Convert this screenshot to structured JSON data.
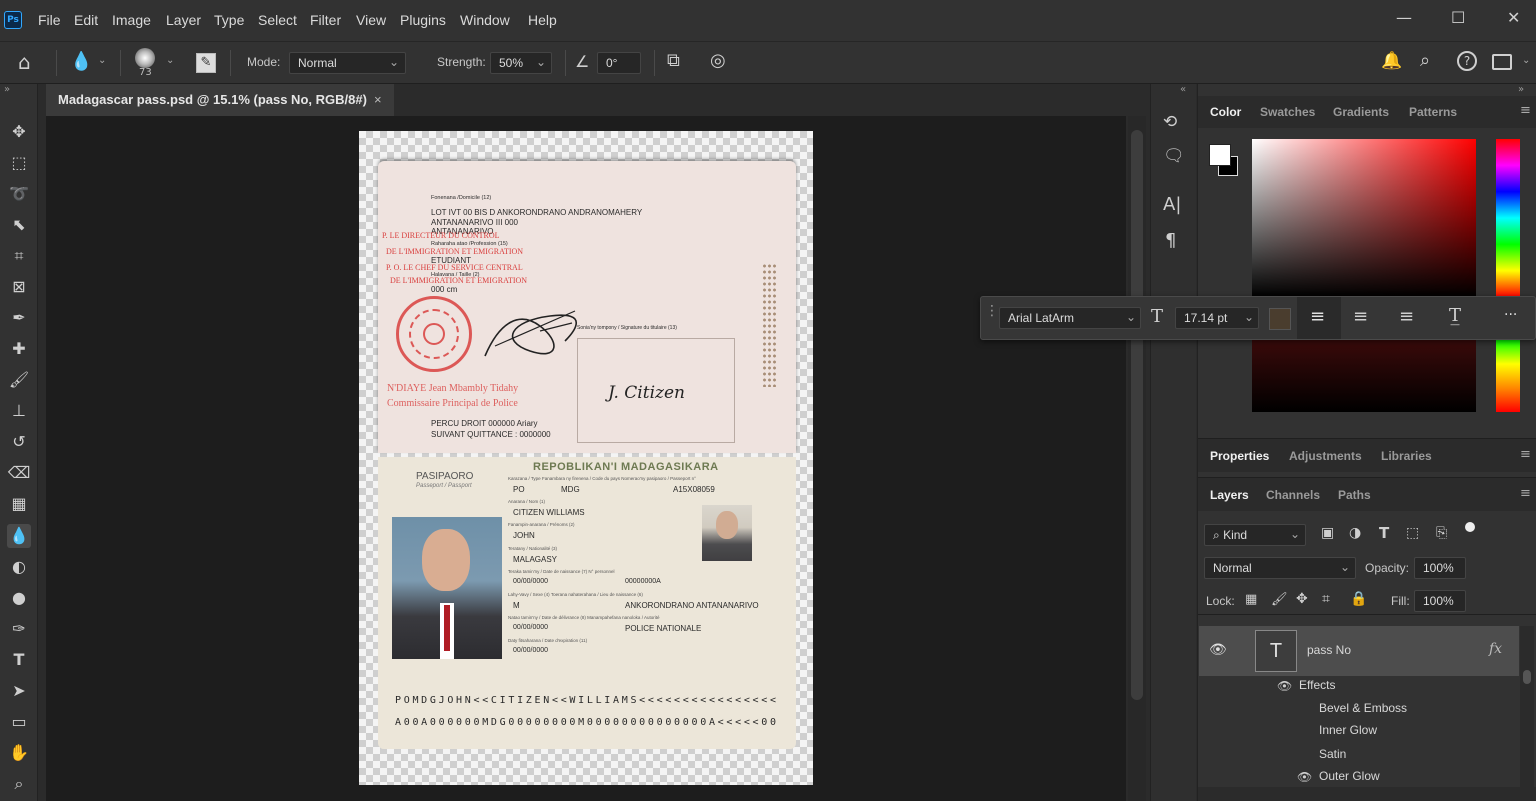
{
  "app": {
    "logo_text": "Ps"
  },
  "menu": [
    "File",
    "Edit",
    "Image",
    "Layer",
    "Type",
    "Select",
    "Filter",
    "View",
    "Plugins",
    "Window",
    "Help"
  ],
  "window_controls": {
    "minimize": "—",
    "maximize": "☐",
    "close": "✕"
  },
  "options": {
    "brush_size": "73",
    "mode_label": "Mode:",
    "mode_value": "Normal",
    "strength_label": "Strength:",
    "strength_value": "50%",
    "angle_value": "0°"
  },
  "document_tab": {
    "title": "Madagascar pass.psd @ 15.1% (pass No, RGB/8#)",
    "close": "×"
  },
  "passport": {
    "upper": {
      "domicile_label": "Fonenana /Domicile (12)",
      "address_line1": "LOT IVT 00 BIS D  ANKORONDRANO ANDRANOMAHERY",
      "address_line2": "ANTANANARIVO III  000",
      "address_line3": "ANTANANARIVO",
      "stamp_line1": "P. LE DIRECTEUR DU CONTROL",
      "profession_label": "Raharaha atao /Profession (15)",
      "stamp_line2": "DE L'IMMIGRATION ET EMIGRATION",
      "profession_value": "ETUDIANT",
      "stamp_line3": "P. O. LE CHEF DU SERVICE CENTRAL",
      "height_label": "Halavana / Taille (2)",
      "stamp_line4": "DE L'IMMIGRATION ET EMIGRATION",
      "height_value": "000 cm",
      "signature_label": "Sonia'ny tompony / Signature du titulaire (13)",
      "signature_text": "J. Citizen",
      "officer_name": "N'DIAYE Jean Mbambly Tidahy",
      "officer_title": "Commissaire Principal de Police",
      "fee_line1": "PERCU DROIT 000000 Ariary",
      "fee_line2": "SUIVANT QUITTANCE : 0000000"
    },
    "lower": {
      "doc_type": "PASIPAORO",
      "doc_type_sub": "Passeport / Passport",
      "country_header": "REPOBLIKAN'I MADAGASIKARA",
      "type_label": "Karazana / Type   Fanambara ny firenena / Code du pays  Nomerao'ny pasipaoro / Passeport n°",
      "type_value": "PO",
      "country_code": "MDG",
      "passport_no": "A15X08059",
      "surname_label": "Anarana / Nom (1)",
      "surname": "CITIZEN WILLIAMS",
      "given_label": "Fanampin-anarana / Prénoms (2)",
      "given": "JOHN",
      "nationality_label": "Teratany / Nationalité (3)",
      "nationality": "MALAGASY",
      "dob_label": "Teraka tamin'ny / Date de naissance (7)  N° personnel",
      "dob": "00/00/0000",
      "personal_no": "00000000A",
      "sex_label": "Lahy-Vavy / Sexe (4)          Toerana nahaterahana / Lieu de naissance (6)",
      "sex": "M",
      "birthplace": "ANKORONDRANO ANTANANARIVO",
      "issue_label": "Natao tamin'ny / Date de délivrance (8)   Manampahefana nanoloka / Autorité",
      "issue_date": "00/00/0000",
      "authority": "POLICE NATIONALE",
      "expiry_label": "Daty fitsaharana / Date d'expiration (11)",
      "expiry_date": "00/00/0000",
      "mrz_line1": "POMDGJOHN<<CITIZEN<<WILLIAMS<<<<<<<<<<<<<<<<",
      "mrz_line2": "A00A000000MDG00000000M00000000000000A<<<<<00"
    }
  },
  "character_bar": {
    "font": "Arial LatArm",
    "size": "17.14 pt",
    "more": "···"
  },
  "color_panel": {
    "tabs": [
      "Color",
      "Swatches",
      "Gradients",
      "Patterns"
    ],
    "active": "Color"
  },
  "properties_tabs": [
    "Properties",
    "Adjustments",
    "Libraries"
  ],
  "layers_panel": {
    "tabs": [
      "Layers",
      "Channels",
      "Paths"
    ],
    "filter_label": "Kind",
    "blend_mode": "Normal",
    "opacity_label": "Opacity:",
    "opacity_value": "100%",
    "lock_label": "Lock:",
    "fill_label": "Fill:",
    "fill_value": "100%",
    "layer_name": "pass No",
    "fx": "fx",
    "effects_label": "Effects",
    "effects": [
      "Bevel & Emboss",
      "Inner Glow",
      "Satin",
      "Outer Glow"
    ]
  },
  "colors": {
    "accent": "#31a8ff",
    "stamp_red": "#d9403f",
    "mrz_ink": "#2a2a2a"
  }
}
